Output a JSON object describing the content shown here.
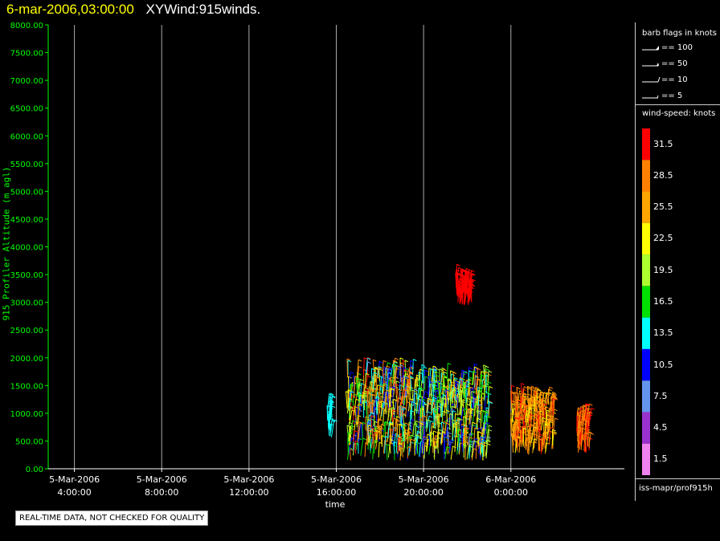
{
  "header": {
    "datetime": "6-mar-2006,03:00:00",
    "product": "XYWind:915winds."
  },
  "chart_data": {
    "type": "scatter",
    "title": "XYWind:915winds.",
    "xlabel": "time",
    "ylabel": "915 Profiler Altitude (m agl)",
    "ylim": [
      0,
      8000
    ],
    "yticks": [
      "0.00",
      "500.00",
      "1000.00",
      "1500.00",
      "2000.00",
      "2500.00",
      "3000.00",
      "3500.00",
      "4000.00",
      "4500.00",
      "5000.00",
      "5500.00",
      "6000.00",
      "6500.00",
      "7000.00",
      "7500.00",
      "8000.00"
    ],
    "x_hours_axis": "hours since 5-Mar-2006 00:00",
    "xlim": [
      2.8,
      29.2
    ],
    "xticks": [
      {
        "hour": 4,
        "date": "5-Mar-2006",
        "time": "4:00:00"
      },
      {
        "hour": 8,
        "date": "5-Mar-2006",
        "time": "8:00:00"
      },
      {
        "hour": 12,
        "date": "5-Mar-2006",
        "time": "12:00:00"
      },
      {
        "hour": 16,
        "date": "5-Mar-2006",
        "time": "16:00:00"
      },
      {
        "hour": 20,
        "date": "5-Mar-2006",
        "time": "20:00:00"
      },
      {
        "hour": 24,
        "date": "6-Mar-2006",
        "time": "0:00:00"
      }
    ],
    "grid": "vertical lines at x ticks",
    "points_description": "wind barbs colored by speed (knots)",
    "wind_clusters": [
      {
        "time_range_hours": [
          15.6,
          15.8
        ],
        "alt_range_m": [
          500,
          1100
        ],
        "speed_kt": 13
      },
      {
        "time_range_hours": [
          16.5,
          19.5
        ],
        "alt_range_m": [
          150,
          1700
        ],
        "speed_kt_range": [
          8,
          32
        ]
      },
      {
        "time_range_hours": [
          19.5,
          23.0
        ],
        "alt_range_m": [
          150,
          1600
        ],
        "speed_kt_range": [
          8,
          28
        ]
      },
      {
        "time_range_hours": [
          21.5,
          22.2
        ],
        "alt_range_m": [
          2950,
          3350
        ],
        "speed_kt": 31
      }
    ],
    "wind_clusters_late": [
      {
        "time_range_hours": [
          24.0,
          26.0
        ],
        "alt_range_m": [
          250,
          1200
        ],
        "speed_kt_range": [
          23,
          31
        ]
      },
      {
        "time_range_hours": [
          27.0,
          27.6
        ],
        "alt_range_m": [
          250,
          900
        ],
        "speed_kt_range": [
          28,
          31
        ]
      }
    ]
  },
  "legend": {
    "barb_title": "barb flags in knots",
    "barb_items": [
      {
        "label": "== 100"
      },
      {
        "label": "== 50"
      },
      {
        "label": "== 10"
      },
      {
        "label": "== 5"
      }
    ],
    "speed_title": "wind-speed: knots",
    "colorbar": [
      {
        "label": "31.5",
        "color": "#ff0000"
      },
      {
        "label": "28.5",
        "color": "#ff8000"
      },
      {
        "label": "25.5",
        "color": "#ffa500"
      },
      {
        "label": "22.5",
        "color": "#ffff00"
      },
      {
        "label": "19.5",
        "color": "#adff2f"
      },
      {
        "label": "16.5",
        "color": "#00e000"
      },
      {
        "label": "13.5",
        "color": "#00ffff"
      },
      {
        "label": "10.5",
        "color": "#0000ff"
      },
      {
        "label": "7.5",
        "color": "#6495ed"
      },
      {
        "label": "4.5",
        "color": "#9932cc"
      },
      {
        "label": "1.5",
        "color": "#ee82ee"
      }
    ],
    "source_path": "iss-mapr/prof915h"
  },
  "notice": "REAL-TIME DATA, NOT CHECKED FOR QUALITY",
  "colors": {
    "axis": "#00ff00",
    "title_time": "#ffff00",
    "grid": "#aaaaaa"
  }
}
